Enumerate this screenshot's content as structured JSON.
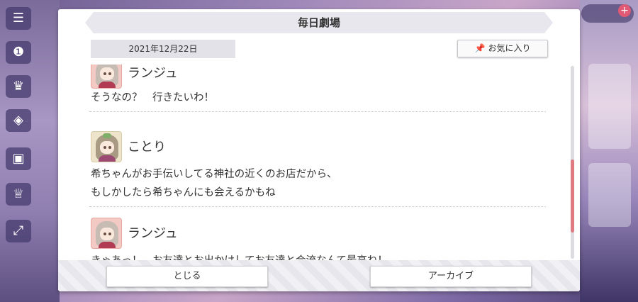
{
  "dialog": {
    "title": "毎日劇場",
    "date": "2021年12月22日",
    "favorite_label": "お気に入り",
    "entries": [
      {
        "speaker": "ランジュ",
        "lines": [
          "そうなの？　行きたいわ！"
        ]
      },
      {
        "speaker": "ことり",
        "lines": [
          "希ちゃんがお手伝いしてる神社の近くのお店だから、",
          "もしかしたら希ちゃんにも会えるかもね"
        ]
      },
      {
        "speaker": "ランジュ",
        "lines": [
          "きゃあっ！　お友達とお出かけしてお友達と合流なんて最高ね！"
        ]
      }
    ],
    "close_label": "とじる",
    "archive_label": "アーカイブ"
  },
  "colors": {
    "scroll_thumb": "#e07a82",
    "accent_pink": "#e05a76"
  },
  "icons": {
    "favorite": "pin-icon",
    "menu": "hamburger-icon",
    "plus": "plus-icon"
  }
}
